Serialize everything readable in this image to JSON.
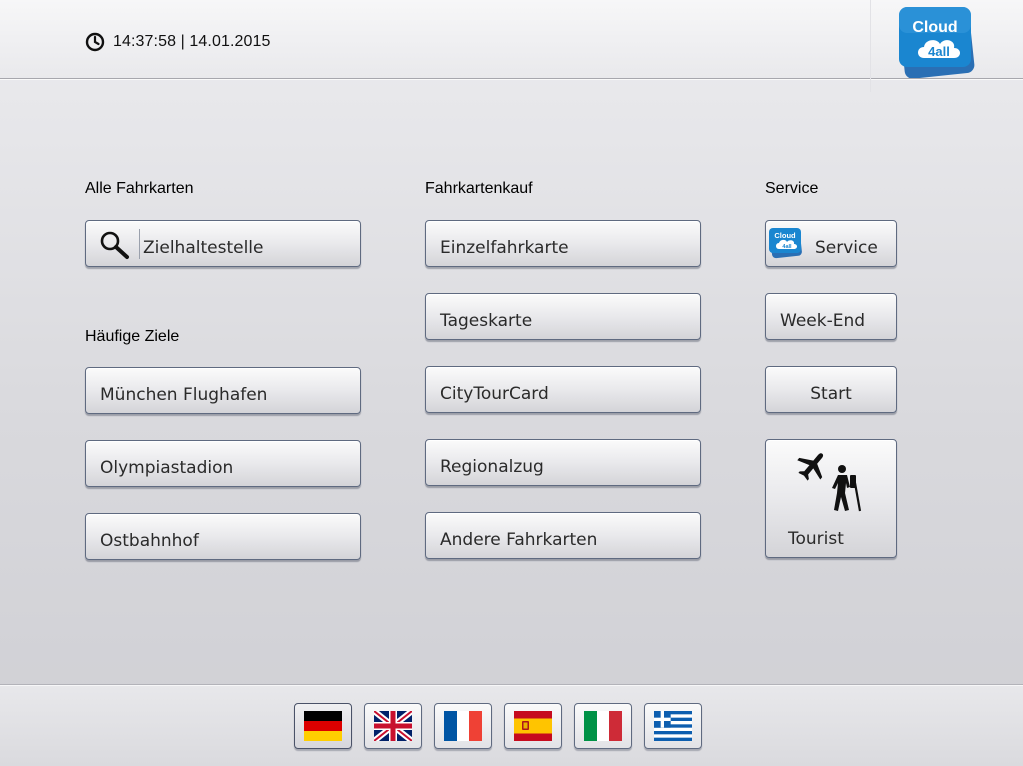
{
  "header": {
    "time": "14:37:58",
    "date": "14.01.2015",
    "datetime_text": "14:37:58 | 14.01.2015",
    "logo": {
      "line1": "Cloud",
      "line2": "4all"
    }
  },
  "columns": {
    "all_tickets": {
      "title": "Alle Fahrkarten",
      "search_button": "Zielhaltestelle"
    },
    "frequent": {
      "title": "Häufige Ziele",
      "items": [
        "München Flughafen",
        "Olympiastadion",
        "Ostbahnhof"
      ]
    },
    "purchase": {
      "title": "Fahrkartenkauf",
      "items": [
        "Einzelfahrkarte",
        "Tageskarte",
        "CityTourCard",
        "Regionalzug",
        "Andere Fahrkarten"
      ]
    },
    "service": {
      "title": "Service",
      "service_button": "Service",
      "service_icon_text": "Cloud 4all",
      "weekend_button": "Week-End",
      "start_button": "Start",
      "tourist_button": "Tourist"
    }
  },
  "languages": [
    {
      "code": "de",
      "flag": "germany-flag",
      "selected": true
    },
    {
      "code": "en",
      "flag": "uk-flag",
      "selected": false
    },
    {
      "code": "fr",
      "flag": "france-flag",
      "selected": false
    },
    {
      "code": "es",
      "flag": "spain-flag",
      "selected": false
    },
    {
      "code": "it",
      "flag": "italy-flag",
      "selected": false
    },
    {
      "code": "gr",
      "flag": "greece-flag",
      "selected": false
    }
  ],
  "colors": {
    "logo_blue": "#1a86d0",
    "button_border": "#5f6a80"
  }
}
